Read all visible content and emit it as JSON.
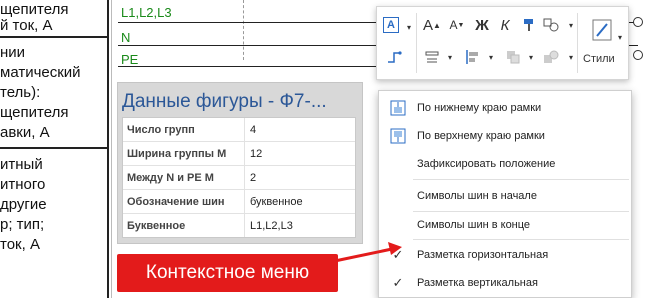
{
  "left_table": {
    "rows": [
      [
        "щепителя",
        "й ток, А"
      ],
      [
        "нии",
        "матический",
        "тель):",
        "щепителя",
        "авки, А"
      ],
      [
        "итный",
        "итного",
        "другие",
        "р; тип;",
        "ток, А"
      ]
    ]
  },
  "buses": {
    "labels": [
      "L1,L2,L3",
      "N",
      "PE"
    ]
  },
  "toolbar": {
    "styles_label": "Стили",
    "font_grow_glyph": "A",
    "font_shrink_glyph": "A",
    "bold_glyph": "Ж",
    "italic_glyph": "К",
    "text_glyph": "A"
  },
  "shape_data": {
    "title": "Данные фигуры - Ф7-...",
    "rows": [
      {
        "property": "Число групп",
        "value": "4"
      },
      {
        "property": "Ширина группы М",
        "value": "12"
      },
      {
        "property": "Между N и PE М",
        "value": "2"
      },
      {
        "property": "Обозначение шин",
        "value": "буквенное"
      },
      {
        "property": "Буквенное",
        "value": "L1,L2,L3"
      }
    ]
  },
  "context_menu": {
    "items": [
      {
        "label": "По нижнему краю рамки",
        "icon": "align-bottom-frame-icon",
        "checked": false
      },
      {
        "label": "По верхнему краю рамки",
        "icon": "align-top-frame-icon",
        "checked": false
      },
      {
        "label": "Зафиксировать положение",
        "icon": "",
        "checked": false
      },
      {
        "label": "Символы шин в начале",
        "icon": "",
        "checked": false
      },
      {
        "label": "Символы шин в конце",
        "icon": "",
        "checked": false
      },
      {
        "label": "Разметка горизонтальная",
        "icon": "check-icon",
        "checked": true
      },
      {
        "label": "Разметка вертикальная",
        "icon": "check-icon",
        "checked": true
      }
    ]
  },
  "callout": {
    "label": "Контекстное меню",
    "color": "#e31b1b"
  },
  "colors": {
    "bus_label": "#1a8a1a",
    "title_blue": "#2b5797",
    "icon_blue": "#2b6cc4"
  }
}
